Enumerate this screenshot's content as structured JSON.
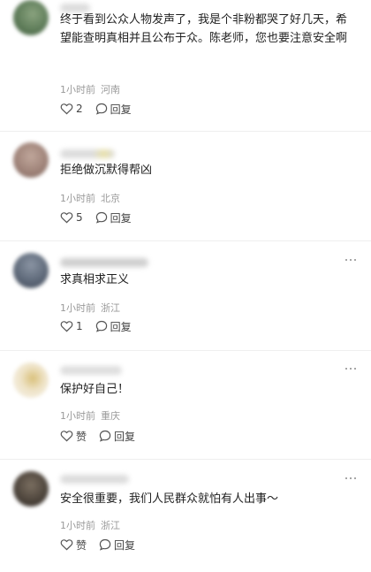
{
  "comments": [
    {
      "text": "终于看到公众人物发声了，我是个非粉都哭了好几天，希望能查明真相并且公布于众。陈老师，您也要注意安全啊",
      "time": "1小时前",
      "location": "河南",
      "likes": "2",
      "reply_label": "回复",
      "avatar_color": "#5f7d5a",
      "name_color": "#dcdcdc"
    },
    {
      "text": "拒绝做沉默得帮凶",
      "time": "1小时前",
      "location": "北京",
      "likes": "5",
      "reply_label": "回复",
      "avatar_color": "#a0847a",
      "name_color": "#d7dcc6"
    },
    {
      "text": "求真相求正义",
      "time": "1小时前",
      "location": "浙江",
      "likes": "1",
      "reply_label": "回复",
      "avatar_color": "#5f6a7a",
      "name_color": "#cfcfcf"
    },
    {
      "text": "保护好自己！",
      "time": "1小时前",
      "location": "重庆",
      "likes": "赞",
      "reply_label": "回复",
      "avatar_color": "#e3d6b8",
      "name_color": "#dedede"
    },
    {
      "text": "安全很重要，我们人民群众就怕有人出事～",
      "time": "1小时前",
      "location": "浙江",
      "likes": "赞",
      "reply_label": "回复",
      "avatar_color": "#4f463d",
      "name_color": "#dcdcdc"
    }
  ],
  "icons": {
    "like": "heart-icon",
    "reply": "comment-bubble-icon",
    "more": "more-dots-icon"
  }
}
